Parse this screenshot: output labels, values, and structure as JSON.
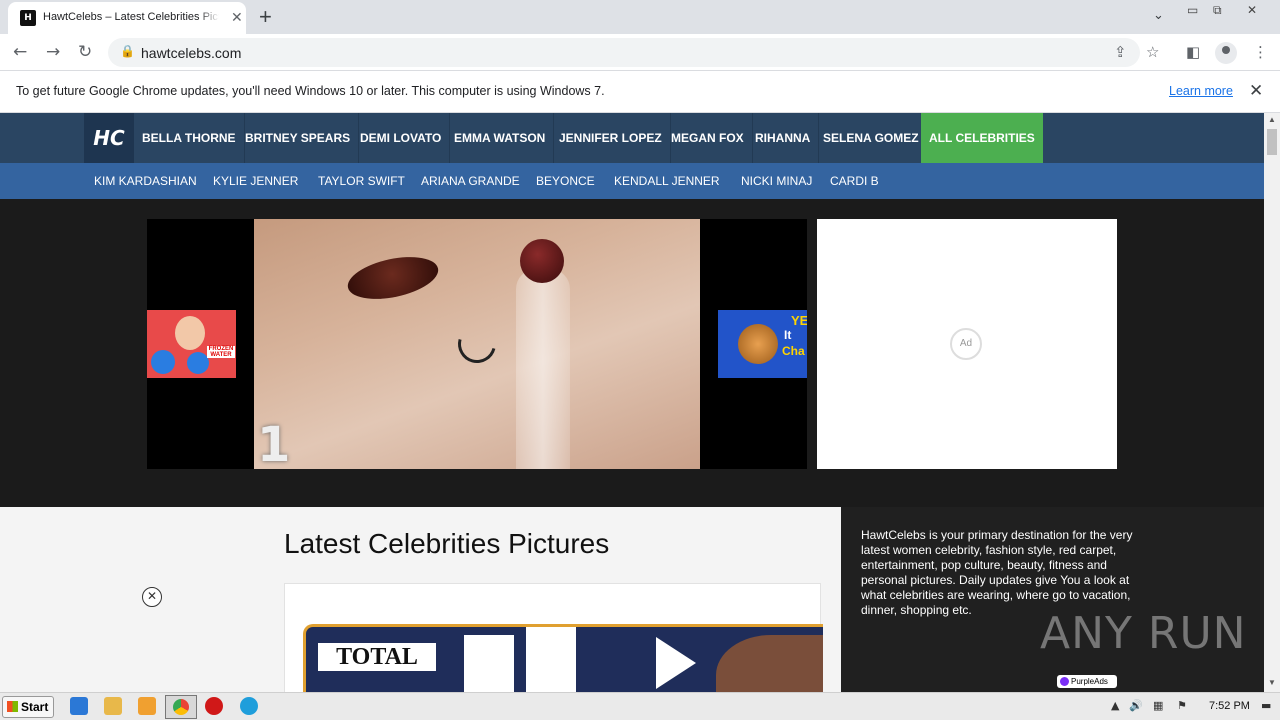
{
  "browser": {
    "tab_title": "HawtCelebs – Latest Celebrities Pictures",
    "favicon_text": "H",
    "url": "hawtcelebs.com",
    "infobar_message": "To get future Google Chrome updates, you'll need Windows 10 or later. This computer is using Windows 7.",
    "infobar_link": "Learn more"
  },
  "site": {
    "logo_text": "HC",
    "nav_primary": [
      "BELLA THORNE",
      "BRITNEY SPEARS",
      "DEMI LOVATO",
      "EMMA WATSON",
      "JENNIFER LOPEZ",
      "MEGAN FOX",
      "RIHANNA",
      "SELENA GOMEZ",
      "ALL CELEBRITIES"
    ],
    "nav_secondary": [
      "KIM KARDASHIAN",
      "KYLIE JENNER",
      "TAYLOR SWIFT",
      "ARIANA GRANDE",
      "BEYONCE",
      "KENDALL JENNER",
      "NICKI MINAJ",
      "CARDI B"
    ],
    "video": {
      "countdown": "1",
      "thumb_left_tag": "FROZEN WATER",
      "thumb_right_lines": [
        "YE",
        "It",
        "Cha"
      ]
    },
    "ad_badge": "Ad",
    "heading": "Latest Celebrities Pictures",
    "poster_text": "TOTAL",
    "about": "HawtCelebs is your primary destination for the very latest women celebrity, fashion style, red carpet, entertainment, pop culture, beauty, fitness and personal pictures. Daily updates give You a look at what celebrities are wearing, where go to vacation, dinner, shopping etc.",
    "purple_ads": "PurpleAds",
    "close_ad": "✕"
  },
  "watermark": "ANY RUN",
  "taskbar": {
    "start_label": "Start",
    "clock": "7:52 PM"
  },
  "colors": {
    "nav_primary_bg": "#2a4562",
    "nav_secondary_bg": "#3464a0",
    "active_nav": "#4caf50"
  }
}
